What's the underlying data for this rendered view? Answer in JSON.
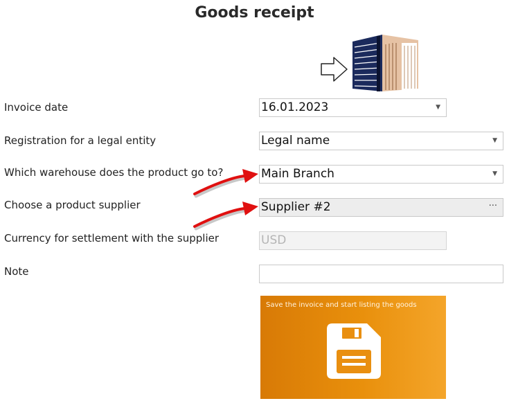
{
  "title": "Goods receipt",
  "fields": {
    "invoice_date": {
      "label": "Invoice date",
      "value": "16.01.2023"
    },
    "legal_entity": {
      "label": "Registration for a legal entity",
      "value": "Legal name"
    },
    "warehouse": {
      "label": "Which warehouse does the product go to?",
      "value": "Main Branch"
    },
    "supplier": {
      "label": "Choose a product supplier",
      "value": "Supplier #2"
    },
    "currency": {
      "label": "Currency for settlement with the supplier",
      "value": "USD"
    },
    "note": {
      "label": "Note",
      "value": ""
    }
  },
  "save_tile": {
    "label": "Save the invoice and start listing the goods"
  },
  "icons": {
    "warehouse": "building-icon",
    "receipt_arrow": "arrow-right-icon",
    "dropdown": "chevron-down-icon",
    "ellipsis": "ellipsis-icon",
    "save": "floppy-disk-icon"
  },
  "colors": {
    "tile_start": "#d87a06",
    "tile_end": "#f4a52a",
    "pointer_arrow": "#e01010"
  }
}
